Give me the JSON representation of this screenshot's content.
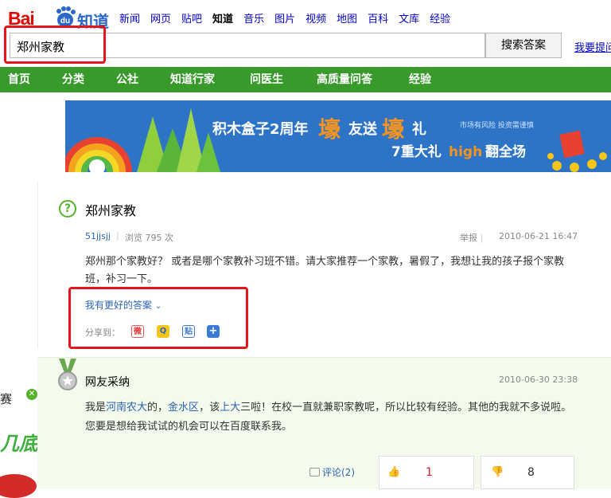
{
  "logo": {
    "text_bai": "Bai",
    "text_du": "du",
    "text_zhidao": "知道"
  },
  "topnav": [
    "新闻",
    "网页",
    "贴吧",
    "知道",
    "音乐",
    "图片",
    "视频",
    "地图",
    "百科",
    "文库",
    "经验"
  ],
  "topnav_active": "知道",
  "search": {
    "value": "郑州家教",
    "button": "搜索答案",
    "ask_link": "我要提问"
  },
  "green_nav": [
    "首页",
    "分类",
    "公社",
    "知道行家",
    "问医生",
    "高质量问答",
    "经验"
  ],
  "banner": {
    "line1_a": "积木盒子2周年",
    "line1_b": "壕",
    "line1_c": "友送",
    "line1_d": "壕",
    "line1_e": "礼",
    "line2_a": "7重大礼",
    "line2_b": "high",
    "line2_c": "翻全场",
    "tagline": "市场有风险 投资需谨慎"
  },
  "question": {
    "title": "郑州家教",
    "user": "51jjsjj",
    "views": "浏览 795 次",
    "report": "举报",
    "date": "2010-06-21 16:47",
    "body": "郑州那个家教好？ 或者是哪个家教补习班不错。请大家推荐一个家教，暑假了，我想让我的孩子报个家教班，补习一下。",
    "better_answer": "我有更好的答案",
    "share_label": "分享到："
  },
  "left_fragments": {
    "sai": "赛",
    "frag": "几底"
  },
  "answer": {
    "title": "网友采纳",
    "date": "2010-06-30 23:38",
    "body_1": "我是",
    "link_1": "河南农大",
    "body_2": "的，",
    "link_2": "金水区",
    "body_3": "，该",
    "link_3": "上大",
    "body_4": "三啦！在校一直就兼职家教呢，所以比较有经验。其他的我就不多说啦。您要是想给我试试的机会可以在百度联系我。",
    "comment": "评论(2)",
    "likes": "1",
    "dislikes": "8"
  },
  "colors": {
    "brand_red": "#e10602",
    "brand_blue": "#2a67c8",
    "nav_green": "#389a2a",
    "link_blue": "#2d64b3",
    "highlight_red": "#e3161d"
  }
}
